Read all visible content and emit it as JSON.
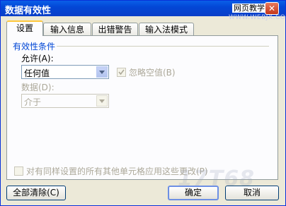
{
  "window": {
    "title": "数据有效性",
    "brand": "网页教学网",
    "brand_url": "WWW.WEBJX.COM"
  },
  "tabs": [
    "设置",
    "输入信息",
    "出错警告",
    "输入法模式"
  ],
  "settings": {
    "group_title": "有效性条件",
    "allow_label": "允许(A):",
    "allow_value": "任何值",
    "ignore_blank_label": "忽略空值(B)",
    "ignore_blank_checked": true,
    "data_label": "数据(D):",
    "data_value": "介于",
    "apply_all_label": "对有同样设置的所有其他单元格应用这些更改(P)",
    "apply_all_checked": false
  },
  "buttons": {
    "clear_all": "全部清除(C)",
    "ok": "确定",
    "cancel": "取消"
  },
  "watermark": "17T68"
}
